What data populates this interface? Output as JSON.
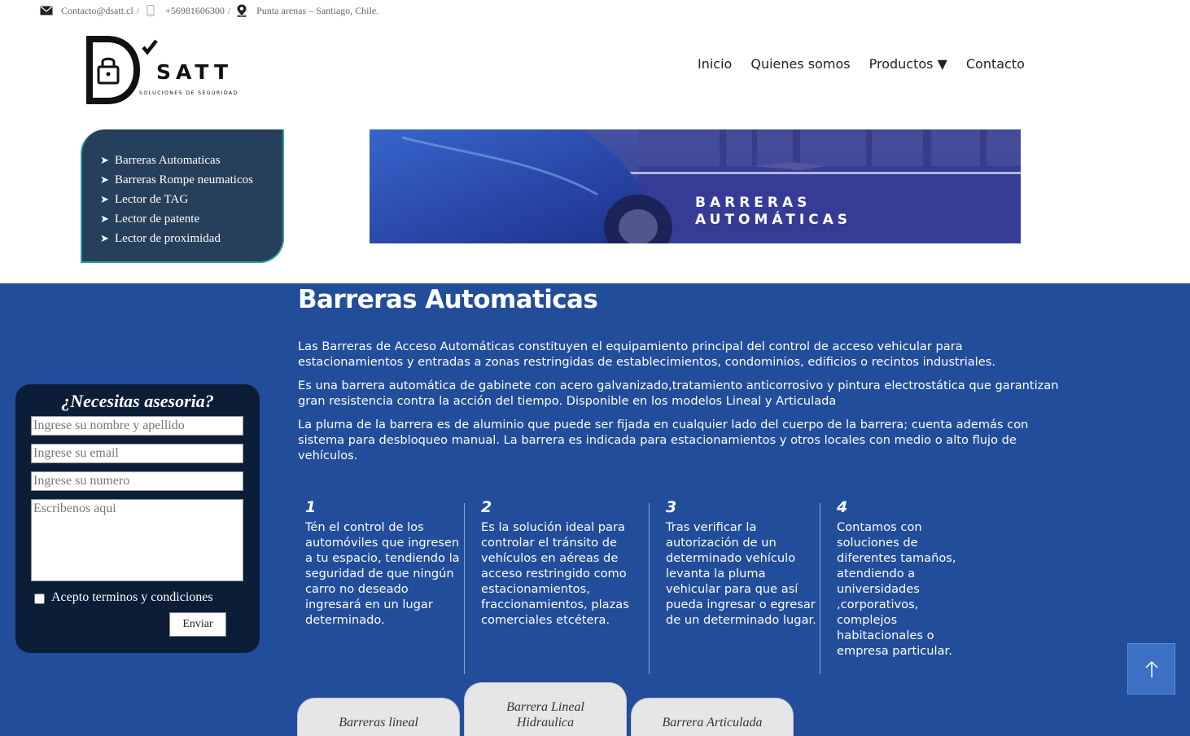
{
  "topbar": {
    "email": "Contacto@dsatt.cl",
    "phone": "+56981606300",
    "location": "Punta arenas – Santiago, Chile.",
    "separator": "/"
  },
  "logo": {
    "brand": "SATT",
    "tagline": "SOLUCIONES DE SEGURIDAD",
    "letter": "D"
  },
  "nav": {
    "items": [
      {
        "label": "Inicio"
      },
      {
        "label": "Quienes somos"
      },
      {
        "label": "Productos ▼"
      },
      {
        "label": "Contacto"
      }
    ]
  },
  "sidebar": {
    "items": [
      {
        "label": "Barreras Automaticas"
      },
      {
        "label": "Barreras Rompe neumaticos"
      },
      {
        "label": "Lector de TAG"
      },
      {
        "label": "Lector de patente"
      },
      {
        "label": "Lector de proximidad"
      }
    ],
    "bullet": "➤"
  },
  "banner": {
    "line1": "BARRERAS",
    "line2": "AUTOMÁTICAS"
  },
  "main": {
    "title": "Barreras Automaticas",
    "paragraphs": [
      "Las Barreras de Acceso Automáticas constituyen el equipamiento principal del control de acceso vehicular para estacionamientos y entradas a zonas restringidas de establecimientos, condominios, edificios o recintos industriales.",
      "Es una barrera automática de gabinete con acero galvanizado,tratamiento anticorrosivo y pintura electrostática que garantizan gran resistencia contra la acción del tiempo. Disponible en los modelos Lineal y Articulada",
      "La pluma de la barrera es de aluminio que puede ser fijada en cualquier lado del cuerpo de la barrera; cuenta además con sistema para desbloqueo manual. La barrera es indicada para estacionamientos y otros locales con medio o alto flujo de vehículos."
    ]
  },
  "form": {
    "title": "¿Necesitas asesoria?",
    "name_placeholder": "Ingrese su nombre y apellido",
    "email_placeholder": "Ingrese su email",
    "phone_placeholder": "Ingrese su numero",
    "message_placeholder": "Escribenos aqui",
    "terms_label": "Acepto terminos y condiciones",
    "submit_label": "Enviar"
  },
  "features": [
    {
      "num": "1",
      "text": "Tén el control de los automóviles que ingresen a tu espacio, tendiendo la seguridad de que ningún carro no deseado ingresará en un lugar determinado."
    },
    {
      "num": "2",
      "text": "Es la solución ideal para controlar el tránsito de vehículos en aéreas de acceso restringido como estacionamientos, fraccionamientos, plazas comerciales etcétera."
    },
    {
      "num": "3",
      "text": "Tras verificar la autorización de un determinado vehículo levanta la pluma vehicular para que así pueda ingresar o egresar de un determinado lugar."
    },
    {
      "num": "4",
      "text": "Contamos con soluciones de diferentes tamaños, atendiendo a universidades ,corporativos, complejos habitacionales o empresa particular."
    }
  ],
  "tabs": [
    {
      "label": "Barreras lineal"
    },
    {
      "label": "Barrera Lineal Hidraulica"
    },
    {
      "label": "Barrera Articulada"
    }
  ],
  "colors": {
    "section_blue": "#224d9b",
    "sidebar_bg": "#263f5a",
    "sidebar_border": "#2a9d9a",
    "form_bg": "#0c1d37",
    "scroll_button": "#3b70c2"
  }
}
